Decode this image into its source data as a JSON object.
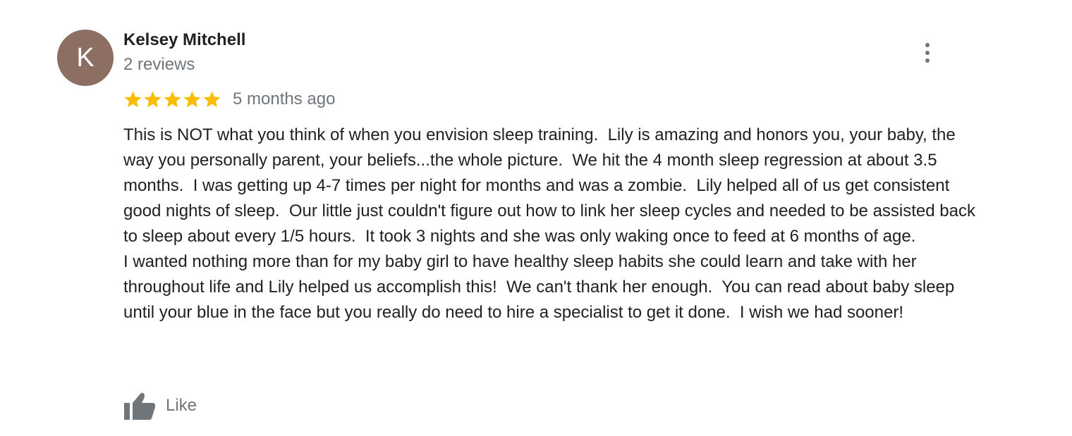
{
  "review": {
    "author": {
      "initial": "K",
      "name": "Kelsey Mitchell",
      "meta": "2 reviews",
      "avatar_color": "#8d6e63"
    },
    "rating": {
      "stars": 5,
      "max_stars": 5,
      "star_color": "#fbbc04",
      "date": "5 months ago"
    },
    "text": "This is NOT what you think of when you envision sleep training.  Lily is amazing and honors you, your baby, the way you personally parent, your beliefs...the whole picture.  We hit the 4 month sleep regression at about 3.5 months.  I was getting up 4-7 times per night for months and was a zombie.  Lily helped all of us get consistent good nights of sleep.  Our little just couldn't figure out how to link her sleep cycles and needed to be assisted back to sleep about every 1/5 hours.  It took 3 nights and she was only waking once to feed at 6 months of age.\nI wanted nothing more than for my baby girl to have healthy sleep habits she could learn and take with her throughout life and Lily helped us accomplish this!  We can't thank her enough.  You can read about baby sleep until your blue in the face but you really do need to hire a specialist to get it done.  I wish we had sooner!",
    "actions": {
      "like_label": "Like",
      "like_icon": "thumbs-up-icon",
      "more_icon": "more-vertical-icon"
    }
  }
}
